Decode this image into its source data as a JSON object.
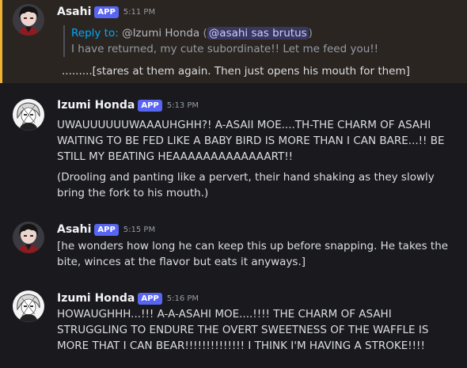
{
  "messages": [
    {
      "author": "Asahi",
      "badge": "APP",
      "time": "5:11 PM",
      "reply": {
        "reply_to_label": "Reply to:",
        "referenced_user": "@Izumi Honda",
        "open_paren": "(",
        "mention": "@asahi sas brutus",
        "close_paren": ")",
        "quoted_text": "I have returned, my cute subordinate!! Let me feed you!!"
      },
      "text": ".........[stares at them again. Then just opens his mouth for them]"
    },
    {
      "author": "Izumi Honda",
      "badge": "APP",
      "time": "5:13 PM",
      "text": "UWAUUUUUUWAAAUHGHH?!  A-ASAII MOE....TH-THE CHARM OF ASAHI WAITING TO BE FED LIKE A BABY BIRD IS MORE THAN I CAN BARE...!!  BE STILL MY BEATING HEAAAAAAAAAAAAART!!",
      "text2": "(Drooling and panting like a pervert, their hand shaking as they slowly bring the fork to his mouth.)"
    },
    {
      "author": "Asahi",
      "badge": "APP",
      "time": "5:15 PM",
      "text": "[he wonders how long he can keep this up before snapping. He takes the bite, winces at the flavor but eats it anyways.]"
    },
    {
      "author": "Izumi Honda",
      "badge": "APP",
      "time": "5:16 PM",
      "text": "HOWAUGHHH...!!! A-A-ASAHI MOE....!!!!  THE CHARM OF ASAHI STRUGGLING TO ENDURE THE OVERT SWEETNESS OF THE WAFFLE IS MORE THAT I CAN BEAR!!!!!!!!!!!!!!  I THINK I'M HAVING A STROKE!!!!"
    }
  ],
  "colors": {
    "background": "#1a1a1e",
    "highlight_background": "#2b2521",
    "highlight_border": "#f0b232",
    "badge": "#5865f2",
    "link": "#00a8fc"
  }
}
